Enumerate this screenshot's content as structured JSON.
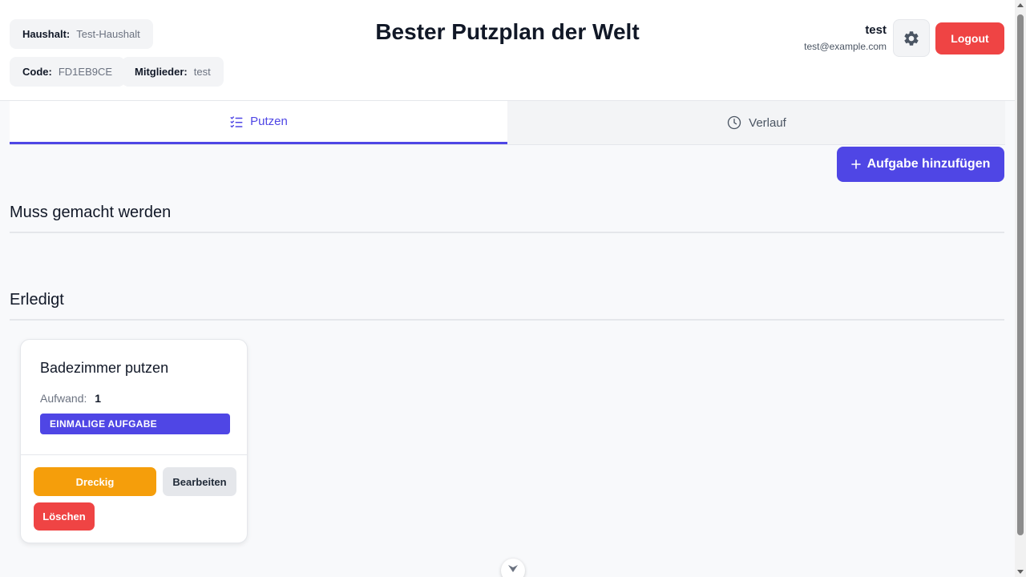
{
  "header": {
    "title": "Bester Putzplan der Welt",
    "household_label": "Haushalt:",
    "household_value": "Test-Haushalt",
    "code_label": "Code:",
    "code_value": "FD1EB9CE",
    "members_label": "Mitglieder:",
    "members_value": "test",
    "user_name": "test",
    "user_email": "test@example.com",
    "settings_icon": "gear-icon",
    "logout_label": "Logout"
  },
  "tabs": [
    {
      "label": "Putzen",
      "icon": "checklist-icon",
      "active": true
    },
    {
      "label": "Verlauf",
      "icon": "clock-icon",
      "active": false
    }
  ],
  "main": {
    "add_task_label": "Aufgabe hinzufügen",
    "add_icon": "plus-icon",
    "section_todo": "Muss gemacht werden",
    "section_done": "Erledigt"
  },
  "tasks_done": [
    {
      "title": "Badezimmer putzen",
      "effort_label": "Aufwand:",
      "effort_value": "1",
      "badge": "EINMALIGE AUFGABE",
      "dirty_label": "Dreckig",
      "edit_label": "Bearbeiten",
      "delete_label": "Löschen"
    }
  ],
  "colors": {
    "accent": "#4f46e5",
    "danger": "#ef4444",
    "warning": "#f59e0b"
  }
}
